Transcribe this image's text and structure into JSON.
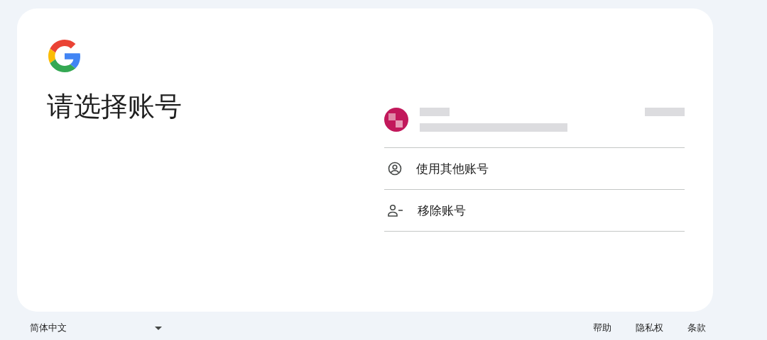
{
  "title": "请选择账号",
  "options": [
    {
      "kind": "other",
      "label": "使用其他账号"
    },
    {
      "kind": "remove",
      "label": "移除账号"
    }
  ],
  "footer": {
    "language": "简体中文",
    "links": [
      "帮助",
      "隐私权",
      "条款"
    ]
  }
}
